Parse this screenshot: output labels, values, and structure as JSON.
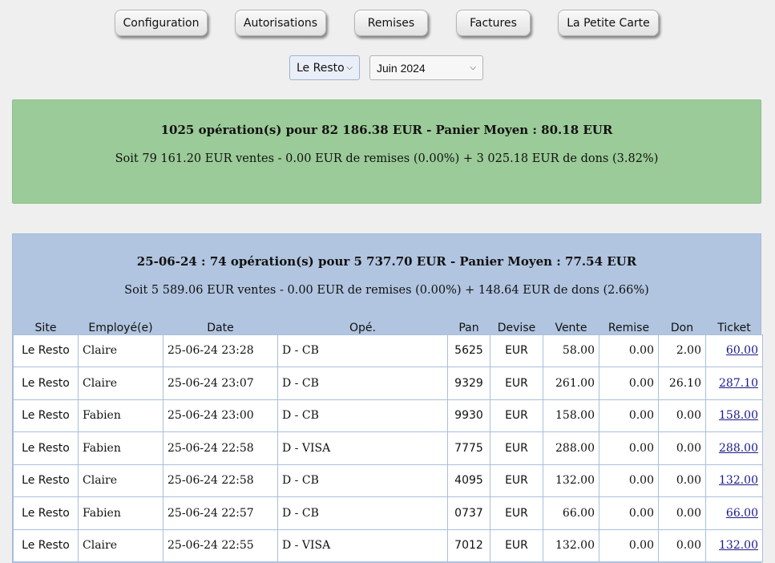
{
  "nav": {
    "buttons": [
      "Configuration",
      "Autorisations",
      "Remises",
      "Factures",
      "La Petite Carte"
    ]
  },
  "filters": {
    "site": "Le Resto",
    "month": "Juin 2024"
  },
  "summary": {
    "line1": "1025 opération(s) pour 82 186.38 EUR - Panier Moyen : 80.18 EUR",
    "line2": "Soit 79 161.20 EUR ventes - 0.00 EUR de remises (0.00%) + 3 025.18 EUR de dons (3.82%)"
  },
  "day": {
    "line1": "25-06-24 : 74 opération(s) pour 5 737.70 EUR - Panier Moyen : 77.54 EUR",
    "line2": "Soit 5 589.06 EUR ventes - 0.00 EUR de remises (0.00%) + 148.64 EUR de dons (2.66%)"
  },
  "table": {
    "columns": [
      "Site",
      "Employé(e)",
      "Date",
      "Opé.",
      "Pan",
      "Devise",
      "Vente",
      "Remise",
      "Don",
      "Ticket"
    ],
    "rows": [
      {
        "site": "Le Resto",
        "employee": "Claire",
        "date": "25-06-24 23:28",
        "op": "D - CB",
        "pan": "5625",
        "currency": "EUR",
        "sale": "58.00",
        "discount": "0.00",
        "donation": "2.00",
        "ticket": "60.00"
      },
      {
        "site": "Le Resto",
        "employee": "Claire",
        "date": "25-06-24 23:07",
        "op": "D - CB",
        "pan": "9329",
        "currency": "EUR",
        "sale": "261.00",
        "discount": "0.00",
        "donation": "26.10",
        "ticket": "287.10"
      },
      {
        "site": "Le Resto",
        "employee": "Fabien",
        "date": "25-06-24 23:00",
        "op": "D - CB",
        "pan": "9930",
        "currency": "EUR",
        "sale": "158.00",
        "discount": "0.00",
        "donation": "0.00",
        "ticket": "158.00"
      },
      {
        "site": "Le Resto",
        "employee": "Fabien",
        "date": "25-06-24 22:58",
        "op": "D - VISA",
        "pan": "7775",
        "currency": "EUR",
        "sale": "288.00",
        "discount": "0.00",
        "donation": "0.00",
        "ticket": "288.00"
      },
      {
        "site": "Le Resto",
        "employee": "Claire",
        "date": "25-06-24 22:58",
        "op": "D - CB",
        "pan": "4095",
        "currency": "EUR",
        "sale": "132.00",
        "discount": "0.00",
        "donation": "0.00",
        "ticket": "132.00"
      },
      {
        "site": "Le Resto",
        "employee": "Fabien",
        "date": "25-06-24 22:57",
        "op": "D - CB",
        "pan": "0737",
        "currency": "EUR",
        "sale": "66.00",
        "discount": "0.00",
        "donation": "0.00",
        "ticket": "66.00"
      },
      {
        "site": "Le Resto",
        "employee": "Claire",
        "date": "25-06-24 22:55",
        "op": "D - VISA",
        "pan": "7012",
        "currency": "EUR",
        "sale": "132.00",
        "discount": "0.00",
        "donation": "0.00",
        "ticket": "132.00"
      }
    ]
  }
}
